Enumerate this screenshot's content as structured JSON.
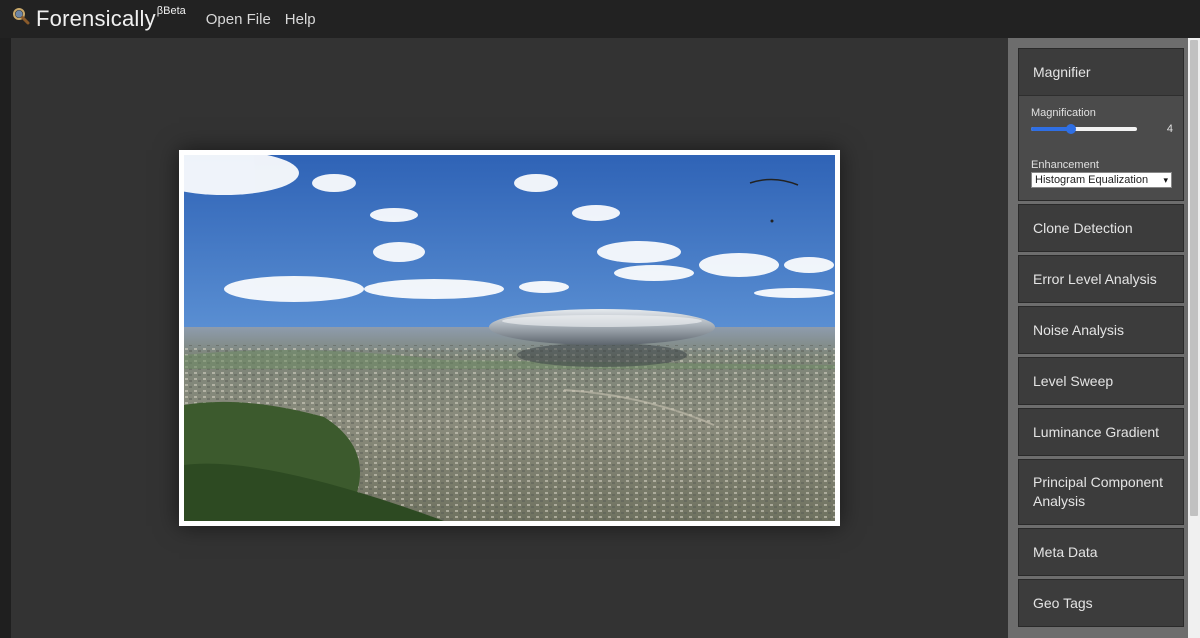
{
  "app": {
    "title": "Forensically",
    "badge": "Beta",
    "logo_icon": "magnifier-icon"
  },
  "menu": {
    "open_file": "Open File",
    "help": "Help"
  },
  "colors": {
    "accent": "#2f6fe4",
    "topbar": "#222222",
    "workspace": "#333333",
    "sidebar": "#6d6d6d",
    "panel": "#3c3c3c"
  },
  "magnifier": {
    "title": "Magnifier",
    "magnification_label": "Magnification",
    "magnification_value": "4",
    "magnification_fraction": 0.36,
    "enhancement_label": "Enhancement",
    "enhancement_selected": "Histogram Equalization"
  },
  "tools": [
    "Clone Detection",
    "Error Level Analysis",
    "Noise Analysis",
    "Level Sweep",
    "Luminance Gradient",
    "Principal Component Analysis",
    "Meta Data",
    "Geo Tags"
  ]
}
